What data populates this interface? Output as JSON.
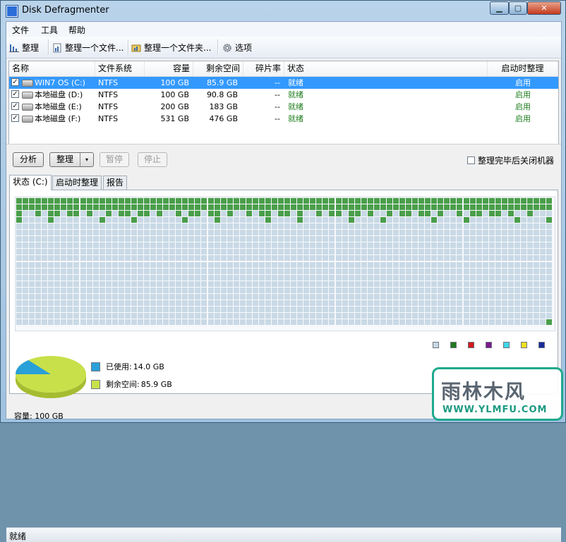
{
  "window": {
    "title": "Disk Defragmenter"
  },
  "window_controls": {
    "minimize": "▁",
    "maximize": "▢",
    "close": "✕"
  },
  "menu": [
    "文件",
    "工具",
    "帮助"
  ],
  "toolbar": {
    "defrag": "整理",
    "defrag_file": "整理一个文件...",
    "defrag_folder": "整理一个文件夹...",
    "options": "选项"
  },
  "columns": [
    "名称",
    "文件系统",
    "容量",
    "剩余空间",
    "碎片率",
    "状态",
    "启动时整理"
  ],
  "drives": [
    {
      "name": "WIN7 OS (C:)",
      "fs": "NTFS",
      "capacity": "100 GB",
      "free": "85.9 GB",
      "frag": "--",
      "status": "就绪",
      "boot": "启用",
      "checked": "✓",
      "selected": true
    },
    {
      "name": "本地磁盘 (D:)",
      "fs": "NTFS",
      "capacity": "100 GB",
      "free": "90.8 GB",
      "frag": "--",
      "status": "就绪",
      "boot": "启用",
      "checked": "✓",
      "selected": false
    },
    {
      "name": "本地磁盘 (E:)",
      "fs": "NTFS",
      "capacity": "200 GB",
      "free": "183 GB",
      "frag": "--",
      "status": "就绪",
      "boot": "启用",
      "checked": "✓",
      "selected": false
    },
    {
      "name": "本地磁盘 (F:)",
      "fs": "NTFS",
      "capacity": "531 GB",
      "free": "476 GB",
      "frag": "--",
      "status": "就绪",
      "boot": "启用",
      "checked": "✓",
      "selected": false
    }
  ],
  "actions": {
    "analyze": "分析",
    "defrag": "整理",
    "defrag_arrow": "▾",
    "pause": "暂停",
    "stop": "停止",
    "shutdown": "整理完毕后关闭机器"
  },
  "tabs": [
    "状态 (C:)",
    "启动时整理",
    "报告"
  ],
  "cluster_map": {
    "colors": {
      "used": "#4a9e4a",
      "free": "#c9d9e6"
    },
    "full_used_rows": 2
  },
  "legend_colors": [
    "#c9d9e6",
    "#1f7a1f",
    "#d11a1a",
    "#7a1a8a",
    "#40d8e8",
    "#f0e020",
    "#1a2a9a"
  ],
  "usage": {
    "used_label": "已使用:",
    "used_value": "14.0 GB",
    "used_gb": 14.0,
    "free_label": "剩余空间:",
    "free_value": "85.9 GB",
    "free_gb": 85.9,
    "used_color": "#2aa0d8",
    "free_color": "#c8e04a",
    "capacity": "容量: 100 GB"
  },
  "statusbar": "就绪",
  "watermark": {
    "text": "雨林木风",
    "url": "WWW.YLMFU.COM"
  }
}
